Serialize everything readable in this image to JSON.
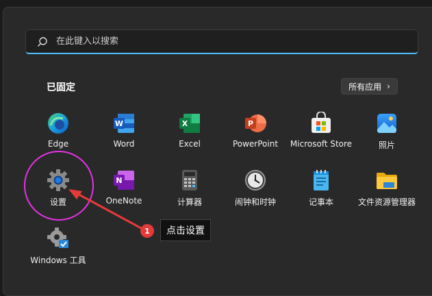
{
  "search": {
    "placeholder": "在此键入以搜索"
  },
  "pinned": {
    "title": "已固定",
    "all_apps_label": "所有应用"
  },
  "apps": [
    {
      "label": "Edge",
      "icon": "edge-icon"
    },
    {
      "label": "Word",
      "icon": "word-icon"
    },
    {
      "label": "Excel",
      "icon": "excel-icon"
    },
    {
      "label": "PowerPoint",
      "icon": "powerpoint-icon"
    },
    {
      "label": "Microsoft Store",
      "icon": "store-icon"
    },
    {
      "label": "照片",
      "icon": "photos-icon"
    },
    {
      "label": "设置",
      "icon": "gear-icon"
    },
    {
      "label": "OneNote",
      "icon": "onenote-icon"
    },
    {
      "label": "计算器",
      "icon": "calculator-icon"
    },
    {
      "label": "闹钟和时钟",
      "icon": "clock-icon"
    },
    {
      "label": "记事本",
      "icon": "notepad-icon"
    },
    {
      "label": "文件资源管理器",
      "icon": "folder-icon"
    },
    {
      "label": "Windows 工具",
      "icon": "tools-icon"
    }
  ],
  "annotation": {
    "step": "1",
    "text": "点击设置",
    "color": "#e534e5"
  },
  "colors": {
    "accent": "#4cc2ff",
    "background": "#292929"
  }
}
